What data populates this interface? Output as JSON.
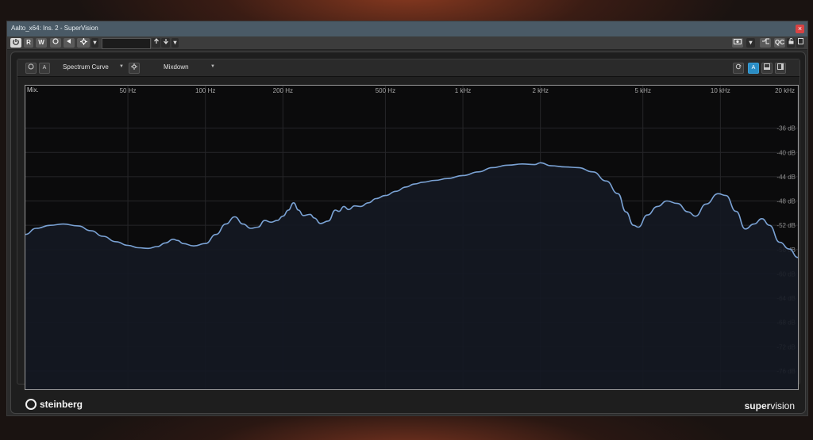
{
  "window": {
    "title": "Aalto_x64: Ins. 2 - SuperVision",
    "close_label": "×"
  },
  "toolbar": {
    "power_icon": "power-icon",
    "read_label": "R",
    "write_label": "W",
    "preset_value": "",
    "qc_label": "QC"
  },
  "module": {
    "mode_label": "Spectrum Curve",
    "source_label": "Mixdown",
    "a_label": "A",
    "active_a_label": "A"
  },
  "chart_data": {
    "type": "line",
    "title": "",
    "corner_label": "Mix.",
    "x_scale": "log",
    "xlim": [
      20,
      20000
    ],
    "ylim": [
      -79,
      -29
    ],
    "x_ticks": [
      {
        "value": 50,
        "label": "50 Hz"
      },
      {
        "value": 100,
        "label": "100 Hz"
      },
      {
        "value": 200,
        "label": "200 Hz"
      },
      {
        "value": 500,
        "label": "500 Hz"
      },
      {
        "value": 1000,
        "label": "1 kHz"
      },
      {
        "value": 2000,
        "label": "2 kHz"
      },
      {
        "value": 5000,
        "label": "5 kHz"
      },
      {
        "value": 10000,
        "label": "10 kHz"
      },
      {
        "value": 20000,
        "label": "20 kHz"
      }
    ],
    "y_ticks": [
      {
        "value": -36,
        "label": "-36 dB"
      },
      {
        "value": -40,
        "label": "-40 dB"
      },
      {
        "value": -44,
        "label": "-44 dB"
      },
      {
        "value": -48,
        "label": "-48 dB"
      },
      {
        "value": -52,
        "label": "-52 dB"
      },
      {
        "value": -56,
        "label": "-56 dB"
      },
      {
        "value": -60,
        "label": "-60 dB"
      },
      {
        "value": -64,
        "label": "-64 dB"
      },
      {
        "value": -68,
        "label": "-68 dB"
      },
      {
        "value": -72,
        "label": "-72 dB"
      },
      {
        "value": -76,
        "label": "-76 dB"
      }
    ],
    "grid": true,
    "series": [
      {
        "color": "#7aa2d4",
        "points": [
          [
            20,
            -53.5
          ],
          [
            22,
            -52.5
          ],
          [
            25,
            -52
          ],
          [
            28,
            -51.8
          ],
          [
            32,
            -52.1
          ],
          [
            36,
            -52.9
          ],
          [
            40,
            -53.8
          ],
          [
            45,
            -54.7
          ],
          [
            50,
            -55.3
          ],
          [
            55,
            -55.7
          ],
          [
            60,
            -55.8
          ],
          [
            65,
            -55.5
          ],
          [
            70,
            -54.9
          ],
          [
            75,
            -54.3
          ],
          [
            78,
            -54.5
          ],
          [
            82,
            -55
          ],
          [
            90,
            -55.4
          ],
          [
            100,
            -55
          ],
          [
            110,
            -53.5
          ],
          [
            120,
            -51.8
          ],
          [
            130,
            -50.6
          ],
          [
            140,
            -51.8
          ],
          [
            150,
            -52.5
          ],
          [
            160,
            -52.3
          ],
          [
            170,
            -51.2
          ],
          [
            180,
            -51.5
          ],
          [
            190,
            -51.2
          ],
          [
            200,
            -50.5
          ],
          [
            210,
            -49.5
          ],
          [
            220,
            -48.3
          ],
          [
            230,
            -49.5
          ],
          [
            240,
            -50.4
          ],
          [
            255,
            -50.2
          ],
          [
            265,
            -50.8
          ],
          [
            280,
            -51.7
          ],
          [
            300,
            -51.3
          ],
          [
            320,
            -49.5
          ],
          [
            330,
            -49.7
          ],
          [
            345,
            -48.9
          ],
          [
            360,
            -49.4
          ],
          [
            380,
            -48.8
          ],
          [
            400,
            -48.9
          ],
          [
            430,
            -48.3
          ],
          [
            460,
            -47.6
          ],
          [
            500,
            -47.1
          ],
          [
            550,
            -46.4
          ],
          [
            600,
            -45.7
          ],
          [
            650,
            -45.2
          ],
          [
            700,
            -44.9
          ],
          [
            780,
            -44.6
          ],
          [
            870,
            -44.3
          ],
          [
            1000,
            -43.8
          ],
          [
            1150,
            -43.2
          ],
          [
            1300,
            -42.5
          ],
          [
            1500,
            -42.1
          ],
          [
            1700,
            -41.9
          ],
          [
            1900,
            -42.0
          ],
          [
            2000,
            -41.7
          ],
          [
            2200,
            -42.2
          ],
          [
            2500,
            -42.4
          ],
          [
            2800,
            -42.5
          ],
          [
            3200,
            -43.2
          ],
          [
            3600,
            -44.7
          ],
          [
            4000,
            -46.8
          ],
          [
            4300,
            -49.8
          ],
          [
            4600,
            -52.0
          ],
          [
            4800,
            -52.3
          ],
          [
            5200,
            -50.3
          ],
          [
            5700,
            -48.9
          ],
          [
            6200,
            -48.0
          ],
          [
            6800,
            -48.4
          ],
          [
            7500,
            -49.8
          ],
          [
            8000,
            -50.5
          ],
          [
            8800,
            -48.5
          ],
          [
            9800,
            -46.8
          ],
          [
            10500,
            -47.1
          ],
          [
            11500,
            -49.7
          ],
          [
            12500,
            -52.6
          ],
          [
            13500,
            -51.8
          ],
          [
            14500,
            -50.9
          ],
          [
            15500,
            -52.0
          ],
          [
            17000,
            -54.8
          ],
          [
            18500,
            -55.9
          ],
          [
            20000,
            -57.3
          ]
        ]
      }
    ]
  }
}
